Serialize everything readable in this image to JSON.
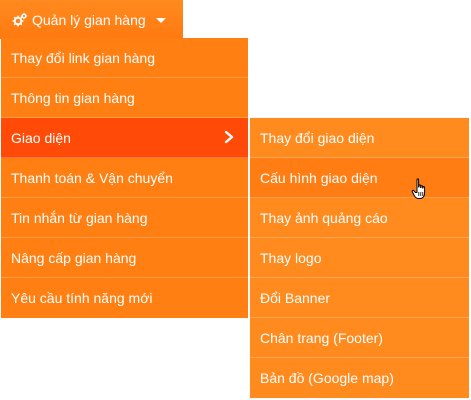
{
  "top_menu": {
    "label": "Quản lý gian hàng",
    "icon": "gears-icon",
    "caret_icon": "caret-down-icon"
  },
  "menu": {
    "items": [
      {
        "label": "Thay đổi link gian hàng"
      },
      {
        "label": "Thông tin gian hàng"
      },
      {
        "label": "Giao diện",
        "active": true,
        "has_submenu": true
      },
      {
        "label": "Thanh toán & Vận chuyển"
      },
      {
        "label": "Tin nhắn từ gian hàng"
      },
      {
        "label": "Nâng cấp gian hàng"
      },
      {
        "label": "Yêu cầu tính năng mới"
      }
    ]
  },
  "submenu": {
    "items": [
      {
        "label": "Thay đổi giao diện"
      },
      {
        "label": "Cấu hình giao diện",
        "hover": true
      },
      {
        "label": "Thay ảnh quảng cáo"
      },
      {
        "label": "Thay logo"
      },
      {
        "label": "Đổi Banner"
      },
      {
        "label": "Chân trang (Footer)"
      },
      {
        "label": "Bản đồ (Google map)"
      }
    ]
  },
  "colors": {
    "menu_bg": "#ff7f12",
    "active_bg": "#ff4a08",
    "submenu_bg": "#ff8a1e",
    "text": "#ffffff"
  }
}
